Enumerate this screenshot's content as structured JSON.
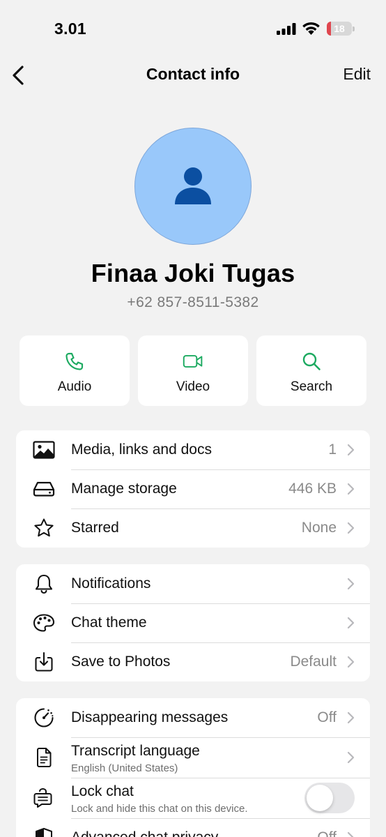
{
  "status_bar": {
    "time": "3.01",
    "battery_level": "18",
    "battery_color": "#e0464f"
  },
  "nav": {
    "back_icon": "chevron-left-icon",
    "title": "Contact info",
    "edit_label": "Edit"
  },
  "contact": {
    "avatar_icon": "person-icon",
    "avatar_color": "#99c8fa",
    "name": "Finaa Joki Tugas",
    "phone": "+62 857-8511-5382"
  },
  "actions": [
    {
      "label": "Audio",
      "icon": "phone-icon"
    },
    {
      "label": "Video",
      "icon": "video-camera-icon"
    },
    {
      "label": "Search",
      "icon": "search-icon"
    }
  ],
  "accent_color": "#1daa61",
  "section_media": [
    {
      "label": "Media, links and docs",
      "value": "1",
      "icon": "photo-icon"
    },
    {
      "label": "Manage storage",
      "value": "446 KB",
      "icon": "storage-drive-icon"
    },
    {
      "label": "Starred",
      "value": "None",
      "icon": "star-icon"
    }
  ],
  "section_settings": [
    {
      "label": "Notifications",
      "value": "",
      "icon": "bell-icon"
    },
    {
      "label": "Chat theme",
      "value": "",
      "icon": "palette-icon"
    },
    {
      "label": "Save to Photos",
      "value": "Default",
      "icon": "download-tray-icon"
    }
  ],
  "section_privacy": {
    "disappearing": {
      "label": "Disappearing messages",
      "value": "Off",
      "icon": "timer-icon"
    },
    "transcript": {
      "label": "Transcript language",
      "sublabel": "English (United States)",
      "icon": "document-icon"
    },
    "lock_chat": {
      "label": "Lock chat",
      "sublabel": "Lock and hide this chat on this device.",
      "icon": "lock-chat-icon",
      "enabled": false
    },
    "advanced": {
      "label": "Advanced chat privacy",
      "value": "Off",
      "icon": "shield-icon"
    }
  }
}
